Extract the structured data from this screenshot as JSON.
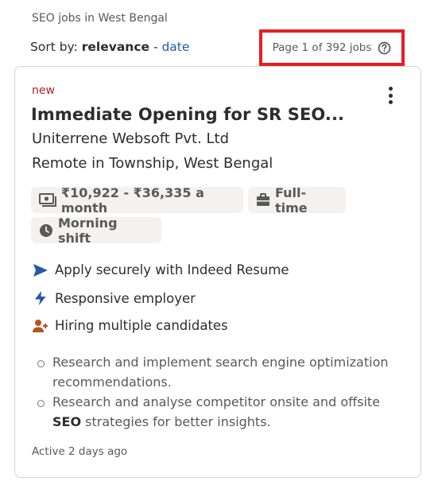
{
  "search_context": "SEO jobs in West Bengal",
  "sort": {
    "prefix": "Sort by: ",
    "active": "relevance",
    "separator": " - ",
    "alternate": "date"
  },
  "page_count": "Page 1 of 392 jobs",
  "job": {
    "badge": "new",
    "title": "Immediate Opening for SR SEO...",
    "company": "Uniterrene Websoft Pvt. Ltd",
    "location": "Remote in Township, West Bengal",
    "salary": "₹10,922 - ₹36,335 a month",
    "job_type": "Full-time",
    "shift": "Morning shift",
    "features": [
      {
        "icon": "send-arrow-icon",
        "label": "Apply securely with Indeed Resume",
        "color": "#2557a7"
      },
      {
        "icon": "lightning-icon",
        "label": "Responsive employer",
        "color": "#2557a7"
      },
      {
        "icon": "add-person-icon",
        "label": "Hiring multiple candidates",
        "color": "#b3541e"
      }
    ],
    "snippet": [
      {
        "text": "Research and implement search engine optimization recommendations."
      },
      {
        "before": "Research and analyse competitor onsite and offsite ",
        "bold": "SEO",
        "after": " strategies for better insights."
      }
    ],
    "activity": "Active 2 days ago"
  },
  "colors": {
    "link": "#2557a7",
    "new_badge": "#a9252b",
    "highlight_border": "#e41e25"
  }
}
